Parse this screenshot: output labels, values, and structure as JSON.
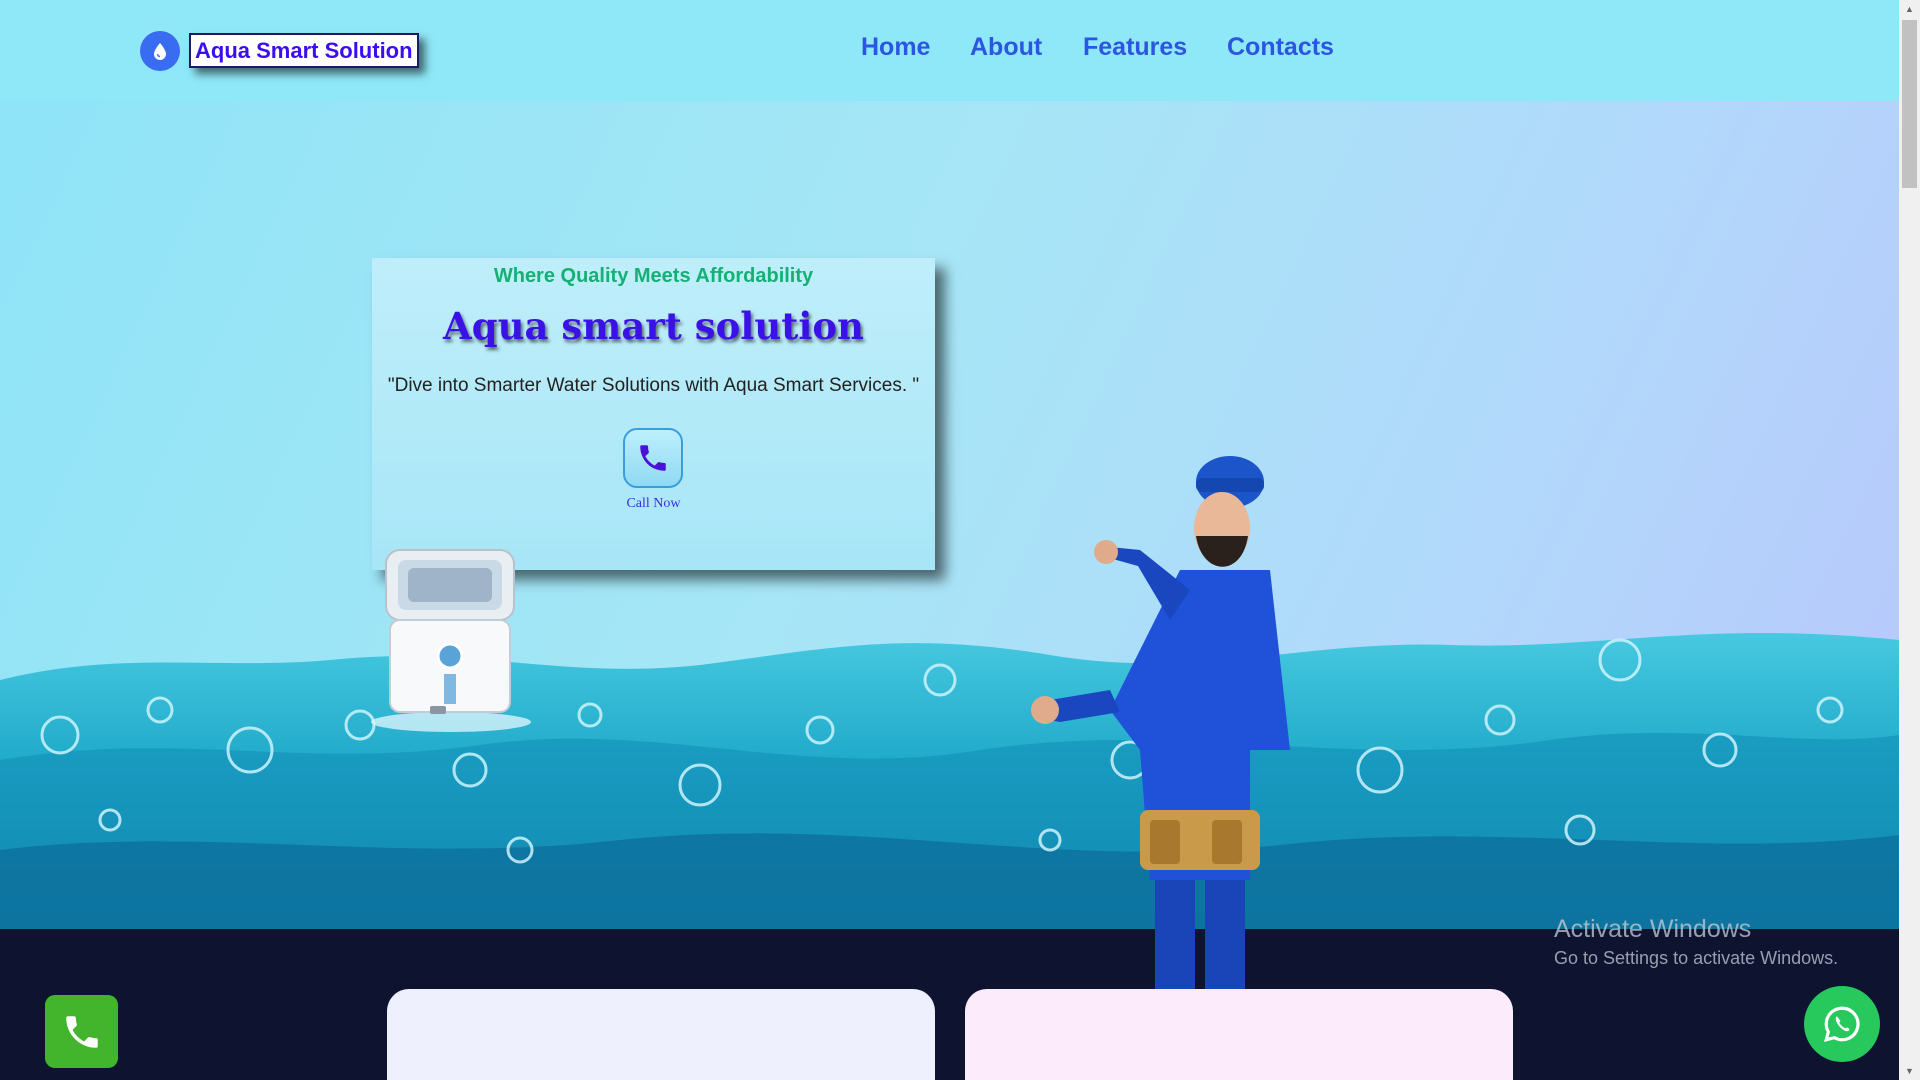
{
  "brand": {
    "name": "Aqua Smart Solution",
    "logo_icon": "water-drop-icon"
  },
  "nav": [
    {
      "label": "Home"
    },
    {
      "label": "About"
    },
    {
      "label": "Features"
    },
    {
      "label": "Contacts"
    }
  ],
  "hero": {
    "tagline": "Where Quality Meets Affordability",
    "title": "Aqua smart solution",
    "quote": "\"Dive into Smarter Water Solutions with Aqua Smart Services. \"",
    "call_label": "Call Now",
    "call_icon": "phone-icon"
  },
  "watermark": {
    "title": "Activate Windows",
    "subtitle": "Go to Settings to activate Windows."
  },
  "floating": {
    "call_icon": "phone-icon",
    "whatsapp_icon": "whatsapp-icon"
  },
  "colors": {
    "brand_text": "#3a0df2",
    "nav_link": "#2c55e0",
    "tagline": "#16b075",
    "dark_section": "#0e1330",
    "whatsapp": "#27c95c",
    "call_green": "#43b52c"
  }
}
